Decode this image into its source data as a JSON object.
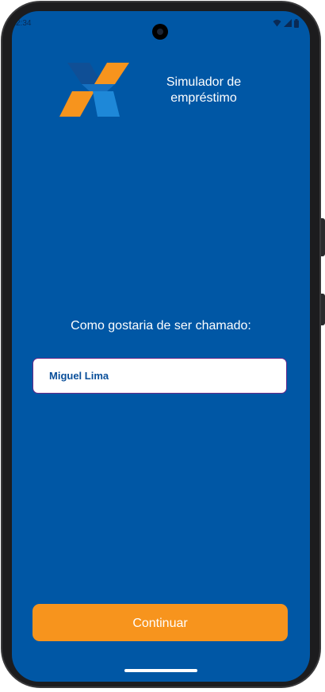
{
  "status_bar": {
    "time": "2:34",
    "icons": [
      "wifi-icon",
      "signal-icon",
      "battery-icon"
    ]
  },
  "header": {
    "logo": "caixa-x-logo",
    "title_line1": "Simulador de",
    "title_line2": "empréstimo"
  },
  "form": {
    "prompt": "Como gostaria de ser chamado:",
    "name_value": "Miguel Lima"
  },
  "actions": {
    "continue_label": "Continuar"
  },
  "colors": {
    "background": "#0057a5",
    "accent_orange": "#f7941d",
    "logo_blue": "#1e88d8",
    "field_text": "#0a4f9a"
  }
}
